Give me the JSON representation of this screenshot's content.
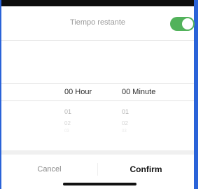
{
  "header": {
    "title": "Tiempo restante",
    "toggle_on": true,
    "toggle_color": "#52b25b"
  },
  "picker": {
    "hours": {
      "selected": "00 Hour",
      "options": [
        "01",
        "02",
        "03"
      ]
    },
    "minutes": {
      "selected": "00 Minute",
      "options": [
        "01",
        "02",
        "03"
      ]
    }
  },
  "footer": {
    "cancel_label": "Cancel",
    "confirm_label": "Confirm"
  }
}
